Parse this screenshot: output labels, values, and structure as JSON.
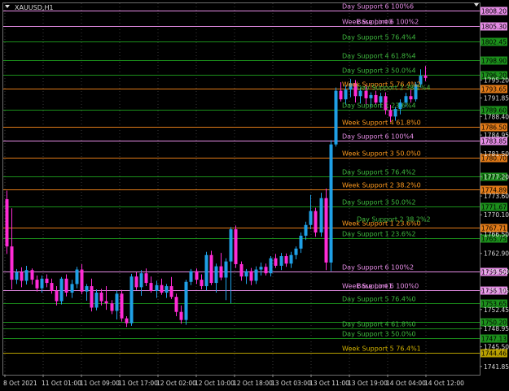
{
  "symbol": "XAUUSD,H1",
  "chart_data": {
    "type": "candlestick",
    "symbol": "XAUUSD,H1",
    "ylim": [
      1740.3,
      1809.5
    ],
    "y_ticks": [
      "1795.20",
      "1791.85",
      "1788.40",
      "1784.95",
      "1781.50",
      "1777.20",
      "1773.60",
      "1770.10",
      "1766.50",
      "1762.90",
      "1759.50",
      "1755.95",
      "1752.45",
      "1748.95",
      "1745.50",
      "1741.85"
    ],
    "x_ticks": [
      "8 Oct 2021",
      "11 Oct 01:00",
      "11 Oct 09:00",
      "11 Oct 17:00",
      "12 Oct 02:00",
      "12 Oct 10:00",
      "12 Oct 18:00",
      "13 Oct 03:00",
      "13 Oct 11:00",
      "13 Oct 19:00",
      "14 Oct 04:00",
      "14 Oct 12:00"
    ],
    "bull_color": "#1fa0e6",
    "bear_color": "#ff2bd6",
    "candles": [
      [
        1773.0,
        1774.6,
        1762.8,
        1764.2
      ],
      [
        1764.2,
        1771.3,
        1756.2,
        1758.0
      ],
      [
        1758.0,
        1760.0,
        1757.2,
        1759.4
      ],
      [
        1759.4,
        1760.3,
        1756.6,
        1757.8
      ],
      [
        1757.8,
        1760.6,
        1757.1,
        1759.8
      ],
      [
        1759.8,
        1760.1,
        1757.1,
        1758.0
      ],
      [
        1758.0,
        1758.8,
        1755.8,
        1756.4
      ],
      [
        1756.4,
        1758.8,
        1755.6,
        1758.2
      ],
      [
        1758.2,
        1759.0,
        1756.6,
        1757.4
      ],
      [
        1757.4,
        1758.2,
        1755.4,
        1755.9
      ],
      [
        1755.9,
        1756.8,
        1753.2,
        1754.0
      ],
      [
        1754.0,
        1758.5,
        1753.4,
        1758.2
      ],
      [
        1758.2,
        1759.0,
        1754.9,
        1755.6
      ],
      [
        1755.6,
        1758.0,
        1754.6,
        1757.2
      ],
      [
        1757.2,
        1760.4,
        1756.4,
        1759.9
      ],
      [
        1759.9,
        1760.9,
        1755.3,
        1755.8
      ],
      [
        1755.8,
        1757.2,
        1754.1,
        1756.8
      ],
      [
        1756.8,
        1758.2,
        1752.1,
        1752.8
      ],
      [
        1752.8,
        1756.2,
        1752.3,
        1755.6
      ],
      [
        1755.6,
        1756.3,
        1753.2,
        1754.0
      ],
      [
        1754.0,
        1756.8,
        1752.4,
        1753.6
      ],
      [
        1753.6,
        1754.2,
        1751.6,
        1752.2
      ],
      [
        1752.2,
        1756.0,
        1750.6,
        1755.4
      ],
      [
        1755.4,
        1756.1,
        1750.2,
        1750.8
      ],
      [
        1750.8,
        1751.2,
        1749.2,
        1749.9
      ],
      [
        1749.9,
        1759.1,
        1749.4,
        1758.6
      ],
      [
        1758.6,
        1759.4,
        1756.1,
        1756.6
      ],
      [
        1756.6,
        1759.8,
        1755.0,
        1759.2
      ],
      [
        1759.2,
        1760.1,
        1756.8,
        1757.4
      ],
      [
        1757.4,
        1758.6,
        1755.6,
        1755.9
      ],
      [
        1755.9,
        1757.8,
        1754.6,
        1757.0
      ],
      [
        1757.0,
        1758.2,
        1755.2,
        1755.6
      ],
      [
        1755.6,
        1757.2,
        1754.6,
        1756.8
      ],
      [
        1756.8,
        1758.5,
        1754.4,
        1754.8
      ],
      [
        1754.8,
        1755.4,
        1751.2,
        1752.0
      ],
      [
        1752.0,
        1753.2,
        1749.8,
        1750.5
      ],
      [
        1750.5,
        1758.0,
        1749.6,
        1757.6
      ],
      [
        1757.6,
        1760.0,
        1757.0,
        1759.6
      ],
      [
        1759.6,
        1760.1,
        1757.2,
        1758.0
      ],
      [
        1758.0,
        1759.0,
        1756.2,
        1756.8
      ],
      [
        1756.8,
        1763.2,
        1756.0,
        1762.6
      ],
      [
        1762.6,
        1763.4,
        1757.0,
        1757.4
      ],
      [
        1757.4,
        1761.0,
        1755.6,
        1760.5
      ],
      [
        1760.5,
        1763.0,
        1757.9,
        1758.4
      ],
      [
        1758.4,
        1762.0,
        1754.2,
        1761.4
      ],
      [
        1761.4,
        1767.8,
        1753.6,
        1767.4
      ],
      [
        1767.4,
        1768.1,
        1760.2,
        1760.9
      ],
      [
        1760.9,
        1761.4,
        1757.8,
        1758.6
      ],
      [
        1758.6,
        1760.0,
        1757.2,
        1759.6
      ],
      [
        1759.6,
        1760.2,
        1757.0,
        1757.8
      ],
      [
        1757.8,
        1760.5,
        1757.2,
        1759.9
      ],
      [
        1759.9,
        1761.2,
        1758.8,
        1760.4
      ],
      [
        1760.4,
        1761.0,
        1758.8,
        1759.2
      ],
      [
        1759.2,
        1762.4,
        1758.6,
        1762.0
      ],
      [
        1762.0,
        1762.8,
        1760.2,
        1760.6
      ],
      [
        1760.6,
        1763.0,
        1759.8,
        1762.4
      ],
      [
        1762.4,
        1762.9,
        1760.4,
        1761.0
      ],
      [
        1761.0,
        1763.2,
        1760.2,
        1762.6
      ],
      [
        1762.6,
        1764.2,
        1761.8,
        1763.8
      ],
      [
        1763.8,
        1766.8,
        1763.0,
        1766.2
      ],
      [
        1766.2,
        1768.8,
        1765.4,
        1768.2
      ],
      [
        1768.2,
        1773.8,
        1767.4,
        1770.8
      ],
      [
        1770.8,
        1771.4,
        1766.0,
        1766.8
      ],
      [
        1766.8,
        1774.2,
        1766.0,
        1773.2
      ],
      [
        1773.2,
        1775.0,
        1759.8,
        1761.2
      ],
      [
        1761.2,
        1784.0,
        1759.6,
        1783.2
      ],
      [
        1783.2,
        1793.8,
        1782.8,
        1793.2
      ],
      [
        1793.2,
        1794.8,
        1791.2,
        1791.6
      ],
      [
        1791.6,
        1794.2,
        1790.6,
        1793.4
      ],
      [
        1793.4,
        1795.4,
        1792.0,
        1794.6
      ],
      [
        1794.6,
        1795.2,
        1791.0,
        1792.2
      ],
      [
        1792.2,
        1793.8,
        1790.8,
        1793.2
      ],
      [
        1793.2,
        1794.2,
        1790.4,
        1791.8
      ],
      [
        1791.8,
        1792.9,
        1790.2,
        1792.4
      ],
      [
        1792.4,
        1793.2,
        1790.6,
        1791.0
      ],
      [
        1791.0,
        1792.8,
        1790.0,
        1792.2
      ],
      [
        1792.2,
        1792.9,
        1788.8,
        1789.6
      ],
      [
        1789.6,
        1790.6,
        1787.4,
        1788.4
      ],
      [
        1788.4,
        1790.2,
        1787.6,
        1789.8
      ],
      [
        1789.8,
        1791.6,
        1788.8,
        1791.0
      ],
      [
        1791.0,
        1792.8,
        1790.2,
        1792.2
      ],
      [
        1792.2,
        1793.4,
        1791.0,
        1791.6
      ],
      [
        1791.6,
        1794.8,
        1791.2,
        1794.4
      ],
      [
        1794.4,
        1797.2,
        1793.8,
        1796.0
      ],
      [
        1796.0,
        1797.8,
        1795.0,
        1795.6
      ]
    ]
  },
  "levels": [
    {
      "label": "Day Support 6 100%6",
      "value": 1808.2,
      "price_tag": "1808.20",
      "color": "#e58ce5",
      "label_color": "#e58ce5"
    },
    {
      "label": "Week Support 6 100%2",
      "value": 1805.3,
      "price_tag": "1805.30",
      "color": "#e58ce5",
      "label_color": "#e58ce5"
    },
    {
      "label": "Day Support 5 76.4%4",
      "value": 1802.45,
      "price_tag": "1802.45",
      "color": "#1b8f1b",
      "label_color": "#3fb93f"
    },
    {
      "label": "Day Support 4 61.8%4",
      "value": 1798.9,
      "price_tag": "1798.90",
      "color": "#1b8f1b",
      "label_color": "#3fb93f"
    },
    {
      "label": "Day Support 3 50.0%4",
      "value": 1796.2,
      "price_tag": "1796.20",
      "color": "#1b8f1b",
      "label_color": "#3fb93f"
    },
    {
      "label": "Week Support 5 76.4%2",
      "value": 1793.65,
      "price_tag": "1793.65",
      "color": "#e07a18",
      "label_color": "#ff9a1e"
    },
    {
      "label": "Day Support 1 23.6%4",
      "value": 1789.6,
      "price_tag": "1789.60",
      "color": "#1b8f1b",
      "label_color": "#3fb93f"
    },
    {
      "label": "Week Support 4 61.8%0",
      "value": 1786.5,
      "price_tag": "1786.50",
      "color": "#e07a18",
      "label_color": "#ff9a1e"
    },
    {
      "label": "Day Support 6 100%4",
      "value": 1783.85,
      "price_tag": "1783.85",
      "color": "#e58ce5",
      "label_color": "#e58ce5"
    },
    {
      "label": "Week Support 3 50.0%0",
      "value": 1780.7,
      "price_tag": "1780.70",
      "color": "#e07a18",
      "label_color": "#ff9a1e"
    },
    {
      "label": "Day Support 5 76.4%2",
      "value": 1777.2,
      "price_tag": "1777.20",
      "color": "#1b8f1b",
      "label_color": "#3fb93f"
    },
    {
      "label": "Week Support 2 38.2%0",
      "value": 1774.89,
      "price_tag": "1774.89",
      "color": "#e07a18",
      "label_color": "#ff9a1e"
    },
    {
      "label": "Day Support 3 50.0%2",
      "value": 1771.67,
      "price_tag": "1771.67",
      "color": "#1b8f1b",
      "label_color": "#3fb93f"
    },
    {
      "label": "Week Support 1 23.6%0",
      "value": 1767.71,
      "price_tag": "1767.71",
      "color": "#e07a18",
      "label_color": "#ff9a1e"
    },
    {
      "label": "Day Support 1 23.6%2",
      "value": 1765.75,
      "price_tag": "1765.75",
      "color": "#1b8f1b",
      "label_color": "#3fb93f"
    },
    {
      "label": "Day Support 6 100%2",
      "value": 1759.5,
      "price_tag": "1759.50",
      "color": "#e58ce5",
      "label_color": "#e58ce5"
    },
    {
      "label": "Week Support 6 100%0",
      "value": 1756.1,
      "price_tag": "1756.10",
      "color": "#e58ce5",
      "label_color": "#e58ce5"
    },
    {
      "label": "Day Support 5 76.4%0",
      "value": 1753.65,
      "price_tag": "1753.65",
      "color": "#1b8f1b",
      "label_color": "#3fb93f"
    },
    {
      "label": "",
      "value": 1750.2,
      "price_tag": "1750.20",
      "color": "#1b8f1b",
      "label_color": "#3fb93f"
    },
    {
      "label": "Day Support 4 61.8%0",
      "value": 1748.95,
      "price_tag": "",
      "color": "#1b8f1b",
      "label_color": "#3fb93f"
    },
    {
      "label": "Day Support 3 50.0%0",
      "value": 1747.13,
      "price_tag": "1747.13",
      "color": "#1b8f1b",
      "label_color": "#3fb93f"
    },
    {
      "label": "Week Support 5 76.4%1",
      "value": 1744.46,
      "price_tag": "1744.46",
      "color": "#b8a000",
      "label_color": "#d2b200"
    }
  ],
  "overlay_labels": [
    {
      "text": "Base Line0",
      "value": 1805.3,
      "color": "#e58ce5"
    },
    {
      "text": "Base Line1",
      "value": 1756.1,
      "color": "#e58ce5"
    },
    {
      "text": "Day Support 2 38.2%4",
      "value": 1793.0,
      "color": "#3fb93f"
    },
    {
      "text": "Day Support 2 38.2%2",
      "value": 1768.4,
      "color": "#3fb93f"
    }
  ]
}
